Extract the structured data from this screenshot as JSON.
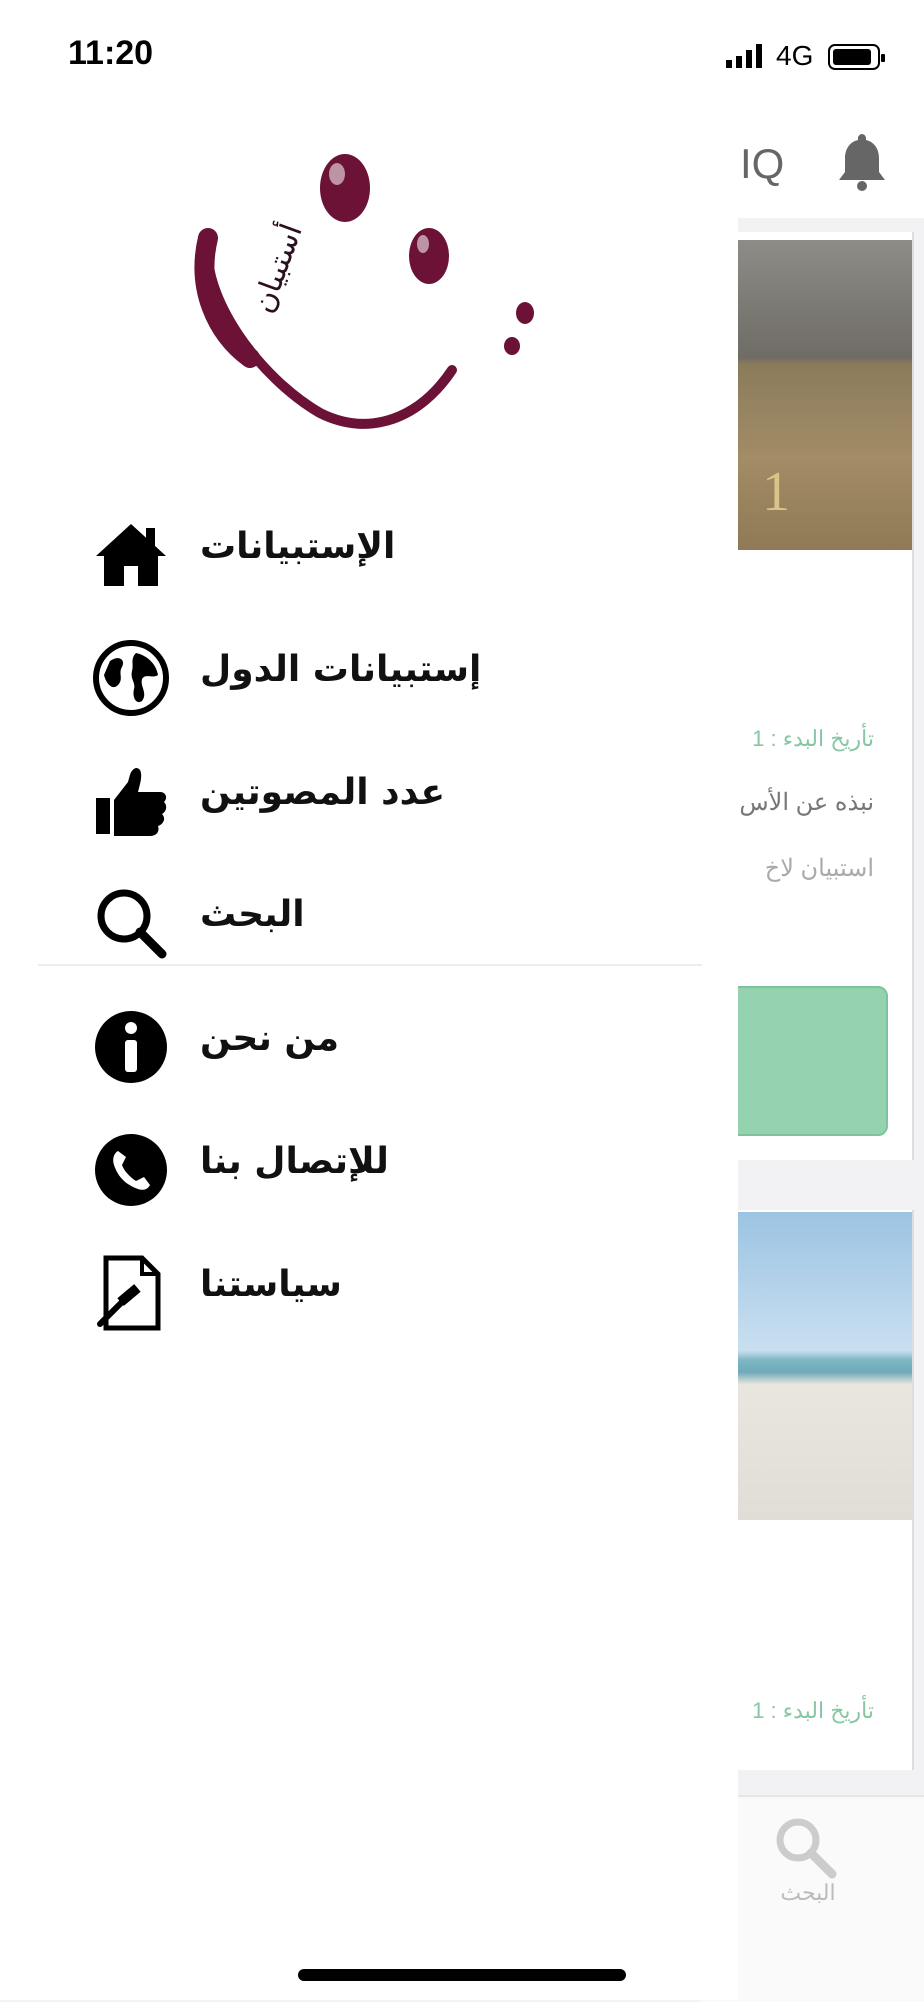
{
  "status_bar": {
    "time": "11:20",
    "network": "4G"
  },
  "background": {
    "header_text": "IQ",
    "cards": [
      {
        "date_label": "تأريخ البدء : 1",
        "description": "نبذه عن الأس",
        "subtitle": "استبيان لاخ",
        "poster_number": "1"
      },
      {
        "date_label": "تأريخ البدء : 1"
      }
    ],
    "tab_bar": {
      "search_label": "البحث"
    }
  },
  "drawer": {
    "menu_items": [
      {
        "label": "الإستبيانات",
        "icon": "home-icon"
      },
      {
        "label": "إستبيانات الدول",
        "icon": "globe-icon"
      },
      {
        "label": "عدد المصوتين",
        "icon": "thumbs-up-icon"
      },
      {
        "label": "البحث",
        "icon": "search-icon"
      },
      {
        "label": "من نحن",
        "icon": "info-icon"
      },
      {
        "label": "للإتصال بنا",
        "icon": "phone-icon"
      },
      {
        "label": "سياستنا",
        "icon": "policy-document-icon"
      }
    ],
    "logo": {
      "text": "أستبيان"
    }
  },
  "colors": {
    "logo": "#6b1236",
    "accent_green": "#95d3b0",
    "date_text": "#86c7a4"
  }
}
